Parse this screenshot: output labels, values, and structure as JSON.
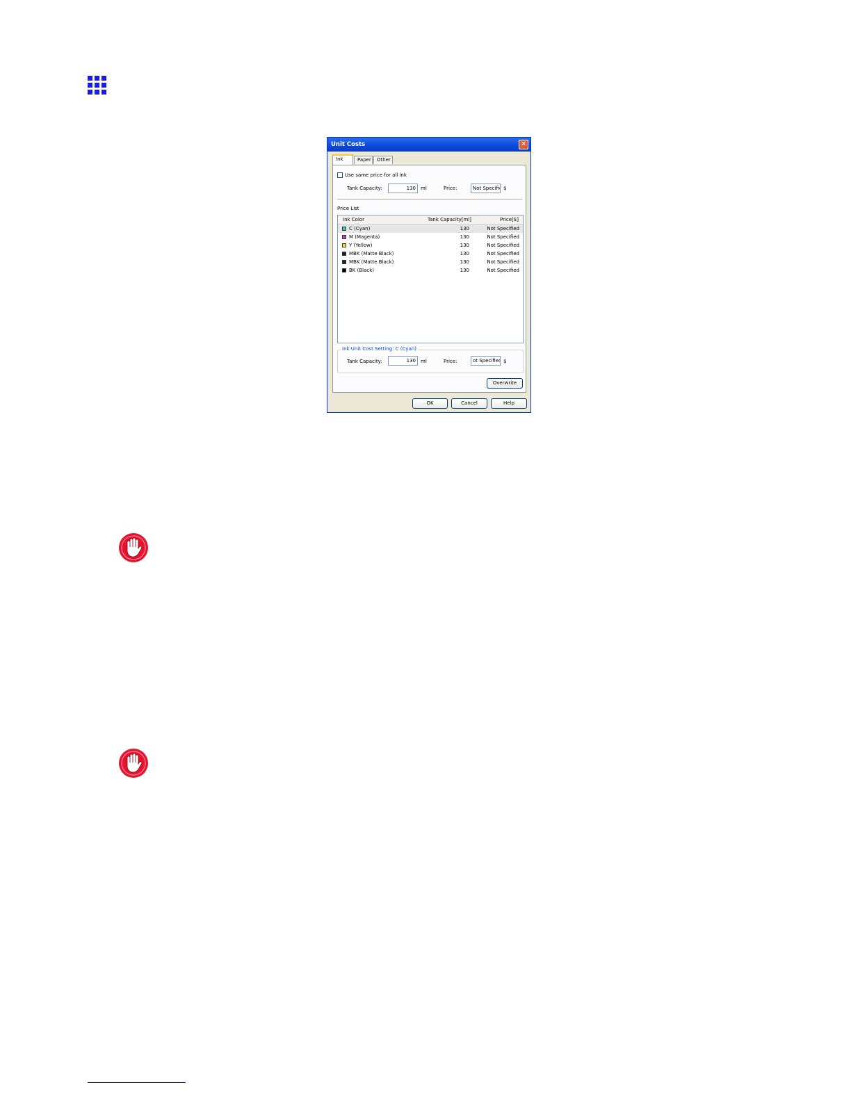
{
  "dialog": {
    "title": "Unit Costs",
    "close_symbol": "✕",
    "tabs": [
      {
        "label": "Ink",
        "active": true
      },
      {
        "label": "Paper",
        "active": false
      },
      {
        "label": "Other",
        "active": false
      }
    ],
    "use_same_price_label": "Use same price for all ink",
    "tank_capacity_label": "Tank Capacity:",
    "tank_capacity_value": "130",
    "unit_ml": "ml",
    "price_label": "Price:",
    "price_value": "Not Specifie",
    "unit_dollar": "$",
    "price_list_label": "Price List",
    "columns": [
      "Ink Color",
      "Tank Capacity[ml]",
      "Price[$]"
    ],
    "rows": [
      {
        "name": "C (Cyan)",
        "capacity": "130",
        "price": "Not Specified",
        "color": "#35c6d8",
        "selected": true
      },
      {
        "name": "M (Magenta)",
        "capacity": "130",
        "price": "Not Specified",
        "color": "#d23ad2",
        "selected": false
      },
      {
        "name": "Y (Yellow)",
        "capacity": "130",
        "price": "Not Specified",
        "color": "#f0e21c",
        "selected": false
      },
      {
        "name": "MBK (Matte Black)",
        "capacity": "130",
        "price": "Not Specified",
        "color": "#222222",
        "selected": false
      },
      {
        "name": "MBK (Matte Black)",
        "capacity": "130",
        "price": "Not Specified",
        "color": "#222222",
        "selected": false
      },
      {
        "name": "BK (Black)",
        "capacity": "130",
        "price": "Not Specified",
        "color": "#000000",
        "selected": false
      }
    ],
    "group_title": "Ink Unit Cost Setting: C (Cyan)",
    "group_tank_capacity_label": "Tank Capacity:",
    "group_tank_capacity_value": "130",
    "group_unit_ml": "ml",
    "group_price_label": "Price:",
    "group_price_value": "ot Specified",
    "group_unit_dollar": "$",
    "overwrite_label": "Overwrite",
    "ok_label": "OK",
    "cancel_label": "Cancel",
    "help_label": "Help"
  },
  "icons": {
    "top_icon": "grid-icon",
    "caution_icon": "stop-hand-icon"
  },
  "colors": {
    "grid_icon": "#1a1ae6",
    "caution_icon": "#e8122e",
    "titlebar": "#0a4ad8"
  }
}
